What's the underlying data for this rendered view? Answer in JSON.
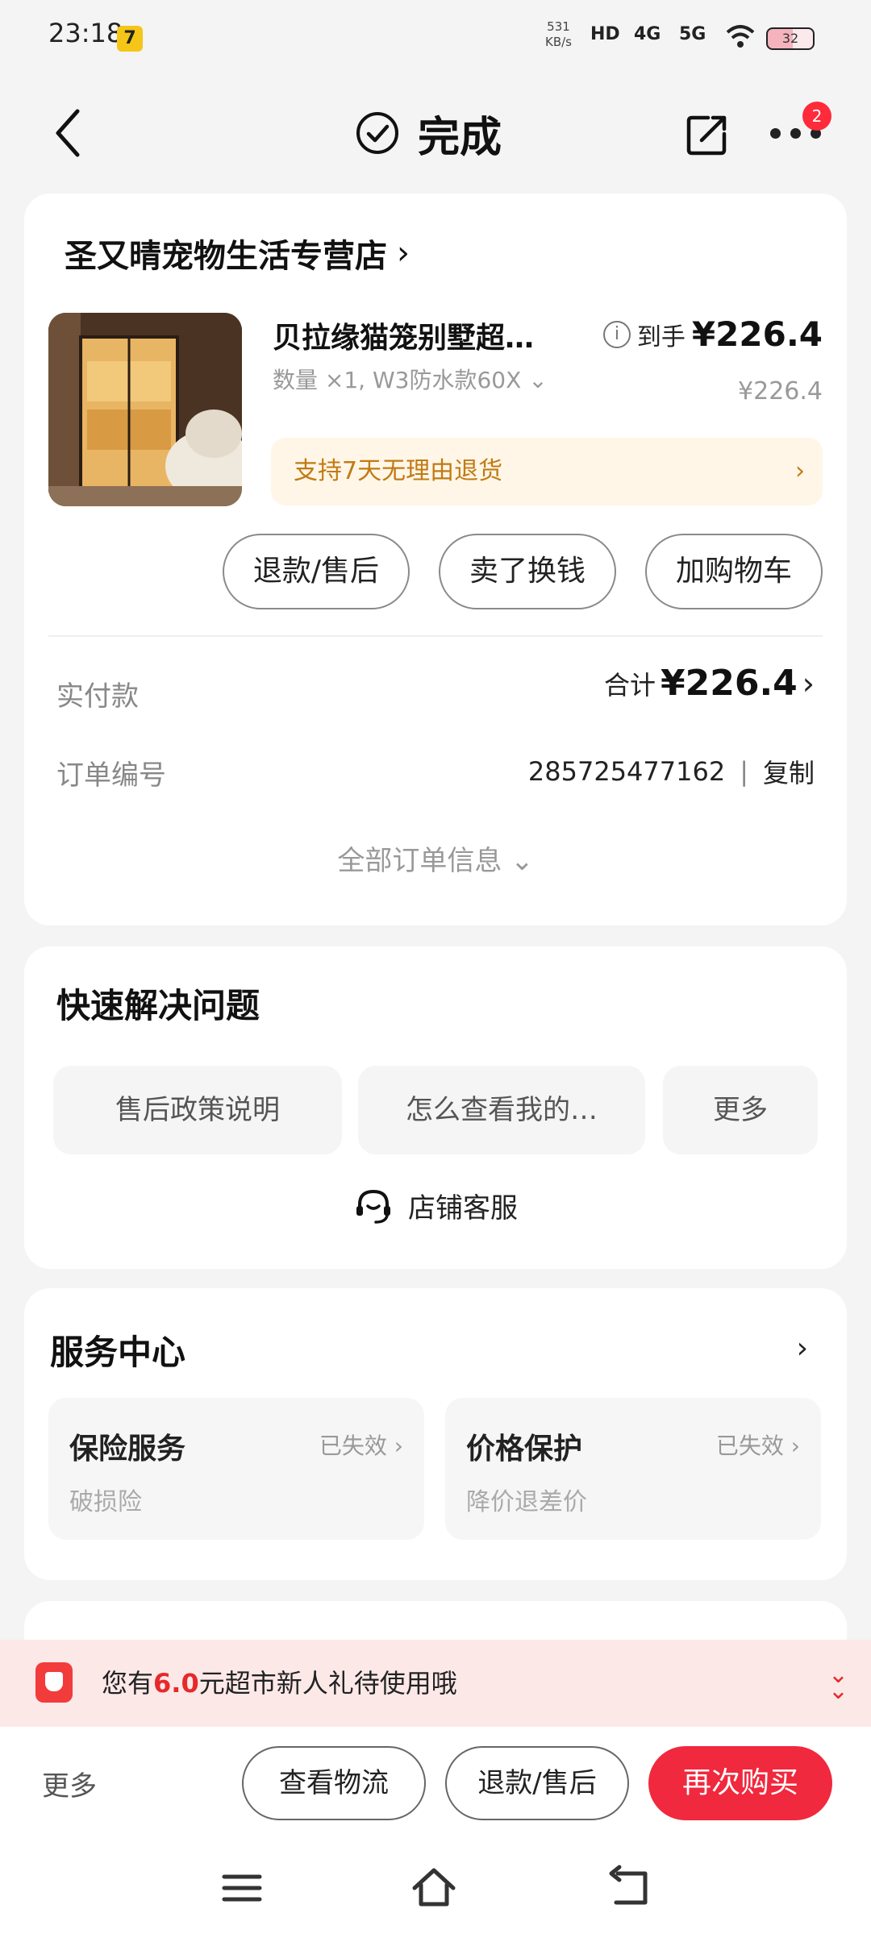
{
  "status_bar": {
    "time": "23:18",
    "app_badge": "7",
    "net_speed_value": "531",
    "net_speed_unit": "KB/s",
    "hd_label": "HD",
    "net1": "4G",
    "net2": "5G",
    "battery": "32"
  },
  "nav": {
    "title": "完成",
    "more_badge": "2"
  },
  "order": {
    "shop_name": "圣又晴宠物生活专营店",
    "product_name": "贝拉缘猫笼别墅超…",
    "product_spec": "数量 ×1, W3防水款60X",
    "price_label": "到手",
    "price_final": "¥226.4",
    "price_original": "¥226.4",
    "return_policy": "支持7天无理由退货",
    "buttons": [
      "退款/售后",
      "卖了换钱",
      "加购物车"
    ],
    "paid_label": "实付款",
    "total_prefix": "合计",
    "total_amount": "¥226.4",
    "order_no_label": "订单编号",
    "order_no": "285725477162",
    "copy_label": "复制",
    "all_info_label": "全部订单信息"
  },
  "quick": {
    "title": "快速解决问题",
    "chips": [
      "售后政策说明",
      "怎么查看我的…",
      "更多"
    ],
    "customer_service": "店铺客服"
  },
  "service_center": {
    "title": "服务中心",
    "items": [
      {
        "name": "保险服务",
        "status": "已失效",
        "sub": "破损险"
      },
      {
        "name": "价格保护",
        "status": "已失效",
        "sub": "降价退差价"
      }
    ]
  },
  "promo": {
    "text_before": "您有",
    "amount": "6.0",
    "text_after": "元超市新人礼待使用哦"
  },
  "bottom_bar": {
    "more": "更多",
    "logistics": "查看物流",
    "refund": "退款/售后",
    "buy_again": "再次购买"
  },
  "colors": {
    "accent_red": "#f0293e",
    "return_orange": "#c27a12",
    "promo_bg": "#fde8e8"
  },
  "icons": [
    "back-arrow-icon",
    "check-circle-icon",
    "share-icon",
    "more-dots-icon",
    "info-icon",
    "headset-icon",
    "menu-icon",
    "home-icon",
    "back-icon"
  ]
}
